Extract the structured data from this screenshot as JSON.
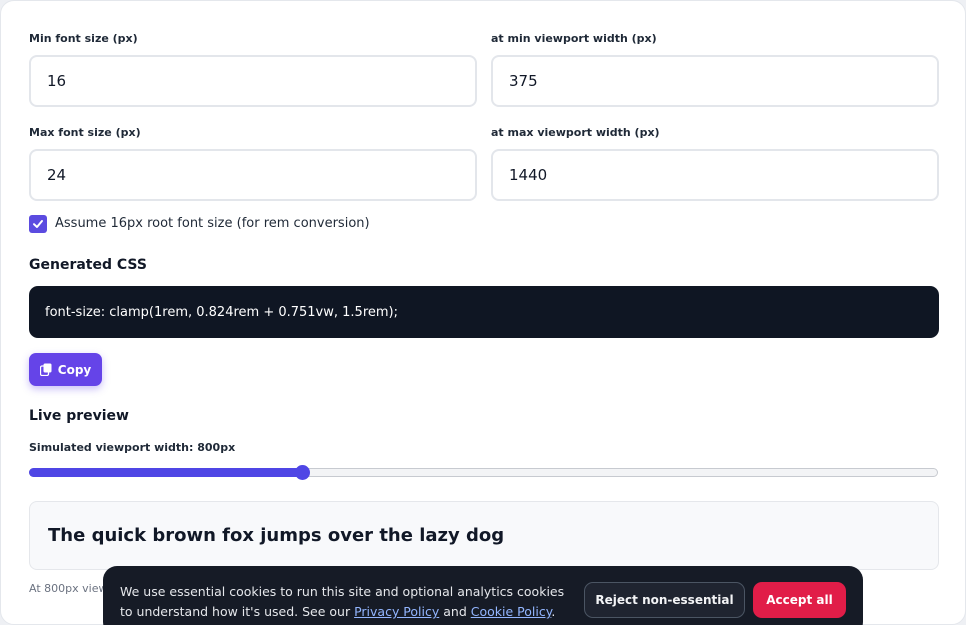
{
  "form": {
    "min_font_label": "Min font size (px)",
    "min_font_value": "16",
    "min_viewport_label": "at min viewport width (px)",
    "min_viewport_value": "375",
    "max_font_label": "Max font size (px)",
    "max_font_value": "24",
    "max_viewport_label": "at max viewport width (px)",
    "max_viewport_value": "1440",
    "rem_checkbox_label": "Assume 16px root font size (for rem conversion)",
    "rem_checkbox_checked": true
  },
  "output": {
    "title": "Generated CSS",
    "css": "font-size: clamp(1rem, 0.824rem + 0.751vw, 1.5rem);",
    "copy_label": "Copy"
  },
  "preview": {
    "title": "Live preview",
    "slider_label": "Simulated viewport width: 800px",
    "slider_fraction": 0.3,
    "sample_text": "The quick brown fox jumps over the lazy dog",
    "note_visible": "At 800px view"
  },
  "cookie": {
    "text_before": "We use essential cookies to run this site and optional analytics cookies to understand how it's used. See our ",
    "privacy_link": "Privacy Policy",
    "and_text": " and ",
    "cookie_link": "Cookie Policy",
    "end_text": ".",
    "reject_label": "Reject non-essential",
    "accept_label": "Accept all"
  },
  "icons": {
    "checkbox": "check-icon",
    "copy": "copy-icon"
  },
  "colors": {
    "accent": "#4f46e5",
    "copy_button": "#6544e8",
    "code_background": "#0f1623",
    "cookie_background": "#161b26",
    "accept_button": "#e11d48"
  }
}
